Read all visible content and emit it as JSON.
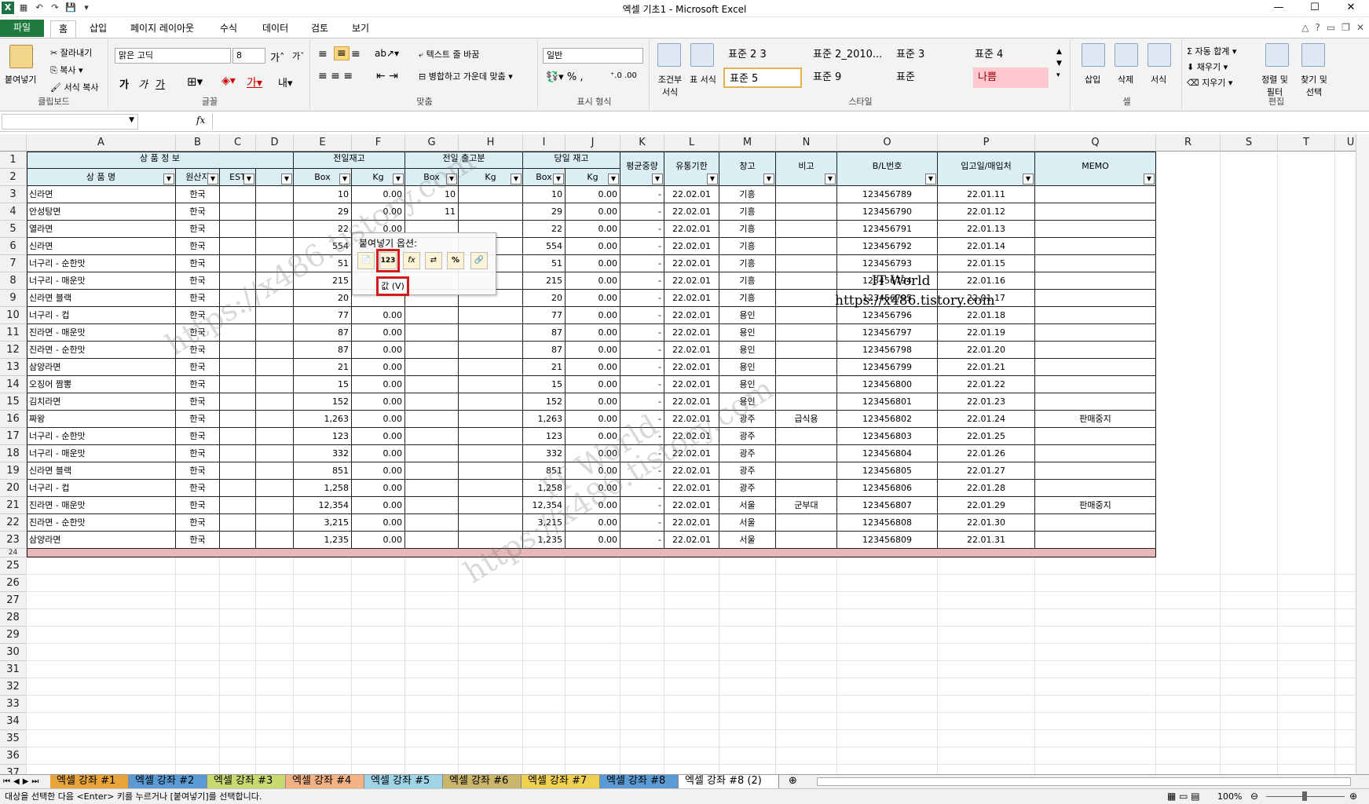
{
  "window": {
    "title": "엑셀 기초1  -  Microsoft Excel",
    "min": "—",
    "max": "☐",
    "close": "✕"
  },
  "tabs": [
    "파일",
    "홈",
    "삽입",
    "페이지 레이아웃",
    "수식",
    "데이터",
    "검토",
    "보기"
  ],
  "ribbon": {
    "clipboard": {
      "paste": "붙여넣기",
      "cut": "잘라내기",
      "copy": "복사",
      "format_painter": "서식 복사",
      "label": "클립보드"
    },
    "font": {
      "name": "맑은 고딕",
      "size": "8",
      "bold": "가",
      "italic": "가",
      "underline": "가",
      "label": "글꼴"
    },
    "align": {
      "wrap": "텍스트 줄 바꿈",
      "merge": "병합하고 가운데 맞춤",
      "label": "맞춤"
    },
    "number": {
      "format": "일반",
      "label": "표시 형식"
    },
    "styles": {
      "cond": "조건부 서식",
      "table": "표 서식",
      "cells": [
        "표준 2 3",
        "표준 2_2010...",
        "표준 3",
        "표준 4",
        "표준 5",
        "표준 9",
        "표준",
        "나쁨"
      ],
      "label": "스타일"
    },
    "cells": {
      "insert": "삽입",
      "delete": "삭제",
      "format": "서식",
      "label": "셀"
    },
    "edit": {
      "autosum": "자동 합계",
      "fill": "채우기",
      "clear": "지우기",
      "sort": "정렬 및 필터",
      "find": "찾기 및 선택",
      "label": "편집"
    }
  },
  "formula": {
    "fx": "fx"
  },
  "columns": [
    "A",
    "B",
    "C",
    "D",
    "E",
    "F",
    "G",
    "H",
    "I",
    "J",
    "K",
    "L",
    "M",
    "N",
    "O",
    "P",
    "Q",
    "R",
    "S",
    "T",
    "U"
  ],
  "header1": {
    "a": "상 품 정 보",
    "ef": "전일재고",
    "gh": "전일 출고분",
    "ij": "당일 재고",
    "k": "평균중량",
    "l": "유통기한",
    "m": "창고",
    "n": "비고",
    "o": "B/L번호",
    "p": "입고일/매입처",
    "q": "MEMO"
  },
  "header2": {
    "a": "상 품 명",
    "b": "원산지",
    "c": "EST",
    "e": "Box",
    "f": "Kg",
    "g": "Box",
    "h": "Kg",
    "i": "Box",
    "j": "Kg"
  },
  "rows": [
    [
      "신라면",
      "한국",
      "10",
      "0.00",
      "10",
      "10",
      "0.00",
      "-",
      "22.02.01",
      "기흥",
      "",
      "123456789",
      "22.01.11",
      ""
    ],
    [
      "안성탕면",
      "한국",
      "29",
      "0.00",
      "11",
      "29",
      "0.00",
      "-",
      "22.02.01",
      "기흥",
      "",
      "123456790",
      "22.01.12",
      ""
    ],
    [
      "열라면",
      "한국",
      "22",
      "0.00",
      "",
      "22",
      "0.00",
      "-",
      "22.02.01",
      "기흥",
      "",
      "123456791",
      "22.01.13",
      ""
    ],
    [
      "신라면",
      "한국",
      "554",
      "",
      "",
      "554",
      "0.00",
      "-",
      "22.02.01",
      "기흥",
      "",
      "123456792",
      "22.01.14",
      ""
    ],
    [
      "너구리 - 순한맛",
      "한국",
      "51",
      "",
      "",
      "51",
      "0.00",
      "-",
      "22.02.01",
      "기흥",
      "",
      "123456793",
      "22.01.15",
      ""
    ],
    [
      "너구리 - 매운맛",
      "한국",
      "215",
      "",
      "",
      "215",
      "0.00",
      "-",
      "22.02.01",
      "기흥",
      "",
      "123456794",
      "22.01.16",
      ""
    ],
    [
      "신라면 블랙",
      "한국",
      "20",
      "",
      "",
      "20",
      "0.00",
      "-",
      "22.02.01",
      "기흥",
      "",
      "123456795",
      "22.01.17",
      ""
    ],
    [
      "너구리 - 컵",
      "한국",
      "77",
      "0.00",
      "",
      "77",
      "0.00",
      "-",
      "22.02.01",
      "용인",
      "",
      "123456796",
      "22.01.18",
      ""
    ],
    [
      "진라면 - 매운맛",
      "한국",
      "87",
      "0.00",
      "",
      "87",
      "0.00",
      "-",
      "22.02.01",
      "용인",
      "",
      "123456797",
      "22.01.19",
      ""
    ],
    [
      "진라면 - 순한맛",
      "한국",
      "87",
      "0.00",
      "",
      "87",
      "0.00",
      "-",
      "22.02.01",
      "용인",
      "",
      "123456798",
      "22.01.20",
      ""
    ],
    [
      "삼양라면",
      "한국",
      "21",
      "0.00",
      "",
      "21",
      "0.00",
      "-",
      "22.02.01",
      "용인",
      "",
      "123456799",
      "22.01.21",
      ""
    ],
    [
      "오징어 짬뽕",
      "한국",
      "15",
      "0.00",
      "",
      "15",
      "0.00",
      "-",
      "22.02.01",
      "용인",
      "",
      "123456800",
      "22.01.22",
      ""
    ],
    [
      "김치라면",
      "한국",
      "152",
      "0.00",
      "",
      "152",
      "0.00",
      "-",
      "22.02.01",
      "용인",
      "",
      "123456801",
      "22.01.23",
      ""
    ],
    [
      "짜왕",
      "한국",
      "1,263",
      "0.00",
      "",
      "1,263",
      "0.00",
      "-",
      "22.02.01",
      "광주",
      "급식용",
      "123456802",
      "22.01.24",
      "판매중지"
    ],
    [
      "너구리 - 순한맛",
      "한국",
      "123",
      "0.00",
      "",
      "123",
      "0.00",
      "-",
      "22.02.01",
      "광주",
      "",
      "123456803",
      "22.01.25",
      ""
    ],
    [
      "너구리 - 매운맛",
      "한국",
      "332",
      "0.00",
      "",
      "332",
      "0.00",
      "-",
      "22.02.01",
      "광주",
      "",
      "123456804",
      "22.01.26",
      ""
    ],
    [
      "신라면 블랙",
      "한국",
      "851",
      "0.00",
      "",
      "851",
      "0.00",
      "-",
      "22.02.01",
      "광주",
      "",
      "123456805",
      "22.01.27",
      ""
    ],
    [
      "너구리 - 컵",
      "한국",
      "1,258",
      "0.00",
      "",
      "1,258",
      "0.00",
      "-",
      "22.02.01",
      "광주",
      "",
      "123456806",
      "22.01.28",
      ""
    ],
    [
      "진라면 - 매운맛",
      "한국",
      "12,354",
      "0.00",
      "",
      "12,354",
      "0.00",
      "-",
      "22.02.01",
      "서울",
      "군부대",
      "123456807",
      "22.01.29",
      "판매중지"
    ],
    [
      "진라면 - 순한맛",
      "한국",
      "3,215",
      "0.00",
      "",
      "3,215",
      "0.00",
      "-",
      "22.02.01",
      "서울",
      "",
      "123456808",
      "22.01.30",
      ""
    ],
    [
      "삼양라면",
      "한국",
      "1,235",
      "0.00",
      "",
      "1,235",
      "0.00",
      "-",
      "22.02.01",
      "서울",
      "",
      "123456809",
      "22.01.31",
      ""
    ]
  ],
  "popup": {
    "title": "붙여넣기 옵션:",
    "value_label": "값 (V)",
    "btn123": "123"
  },
  "overlay": {
    "brand": "IT World",
    "url": "https://x486.tistory.com"
  },
  "sheets": [
    "엑셀 강좌 #1",
    "엑셀 강좌 #2",
    "엑셀 강좌 #3",
    "엑셀 강좌 #4",
    "엑셀 강좌 #5",
    "엑셀 강좌 #6",
    "엑셀 강좌 #7",
    "엑셀 강좌 #8",
    "엑셀 강좌 #8 (2)"
  ],
  "status": {
    "message": "대상을 선택한 다음 <Enter> 키를 누르거나 [붙여넣기]를 선택합니다.",
    "zoom": "100%"
  },
  "colors": {
    "header_fill": "#daeef3",
    "pink_row": "#e6b8b7",
    "accent": "#1f7a3e",
    "popup_highlight": "#d01c1c"
  }
}
